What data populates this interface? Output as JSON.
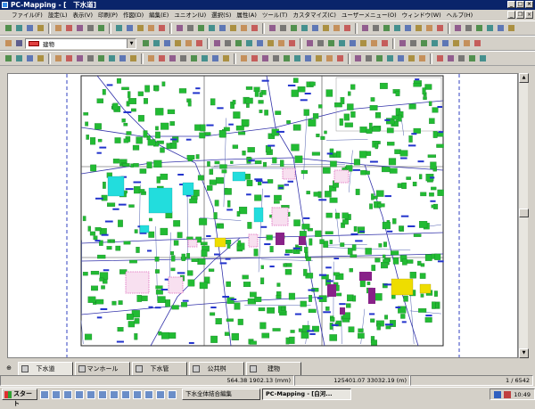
{
  "window": {
    "title": "PC-Mapping - [　下水道]"
  },
  "menu": [
    "ファイル(F)",
    "設定(L)",
    "表示(V)",
    "印刷(P)",
    "作図(D)",
    "編集(E)",
    "ユニオン(U)",
    "選択(S)",
    "属性(A)",
    "ツール(T)",
    "カスタマイズ(C)",
    "ユーザーメニュー(O)",
    "ウィンドウ(W)",
    "ヘルプ(H)"
  ],
  "layer_combo": {
    "value": "建物"
  },
  "tabs": [
    "下水道",
    "マンホール",
    "下水管",
    "公共桝",
    "建物"
  ],
  "active_tab": 0,
  "status": {
    "scale": "564.38  1902.13 (mm)",
    "coords": "125401.07   33032.19 (m)",
    "page": "1 / 6542"
  },
  "taskbar": {
    "start": "スタート",
    "items": [
      "下水全体結合編集",
      "PC-Mapping - [白河..."
    ],
    "clock": "10:49"
  },
  "colors": {
    "title": "#0a246a",
    "building": "#22bb33",
    "pipe": "#2233cc",
    "road": "#3333aa",
    "cyan": "#22dddd",
    "yellow": "#eedd00",
    "purple": "#882288",
    "pink": "#dd66bb"
  },
  "icons": [
    "app-icon",
    "new-icon",
    "open-icon",
    "save-icon",
    "print-icon",
    "zoom-icon",
    "layer-icon",
    "select-icon",
    "pencil-icon",
    "delete-icon"
  ]
}
